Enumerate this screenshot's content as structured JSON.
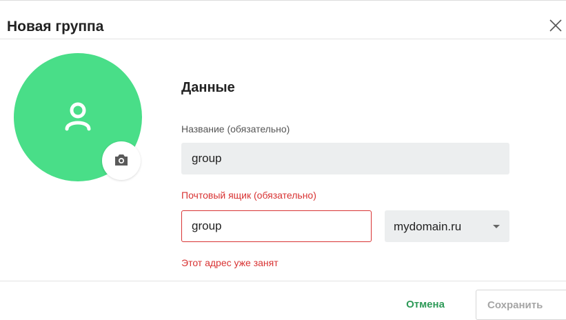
{
  "dialog": {
    "title": "Новая группа"
  },
  "avatar": {
    "color": "#49de88",
    "person_icon": "person-icon",
    "camera_icon": "camera-icon"
  },
  "form": {
    "section_title": "Данные",
    "name_label": "Название (обязательно)",
    "name_value": "group",
    "mailbox_label": "Почтовый ящик (обязательно)",
    "mailbox_value": "group",
    "domain_value": "mydomain.ru",
    "error_text": "Этот адрес уже занят"
  },
  "footer": {
    "cancel_label": "Отмена",
    "save_label": "Сохранить"
  },
  "colors": {
    "accent_green": "#2e9a58",
    "error_red": "#d83232",
    "input_bg": "#eceeef"
  }
}
